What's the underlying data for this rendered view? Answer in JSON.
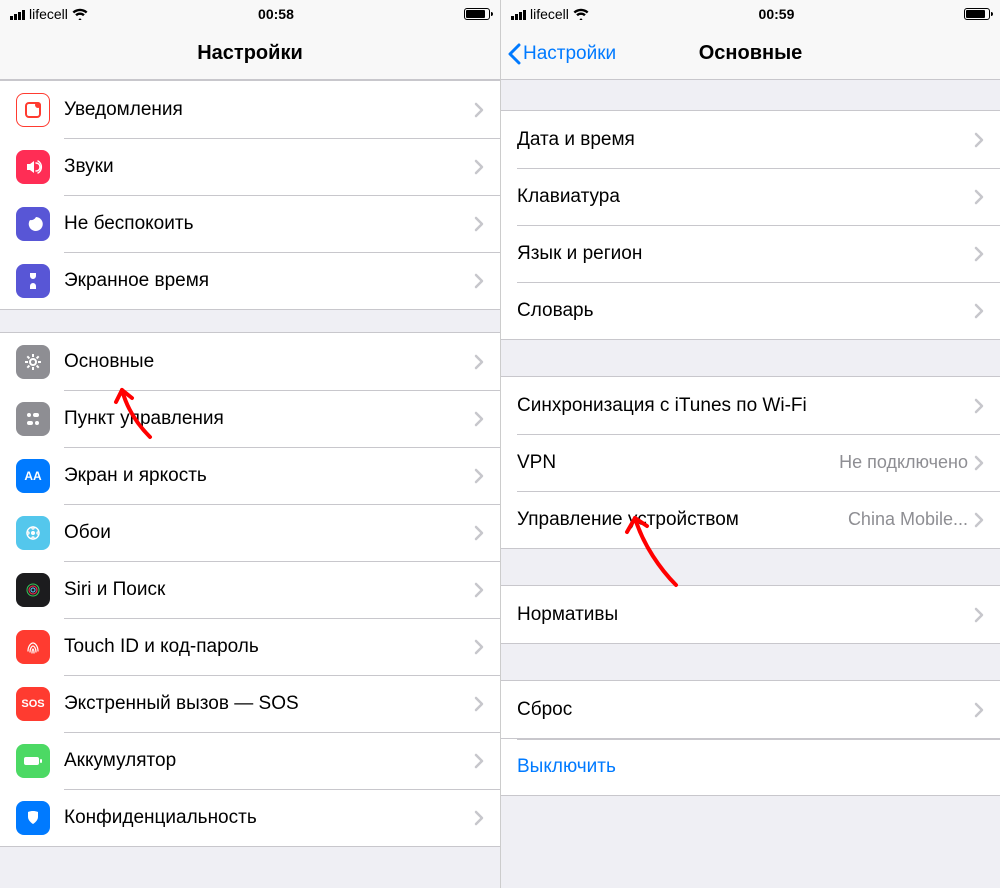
{
  "left": {
    "status": {
      "carrier": "lifecell",
      "time": "00:58"
    },
    "nav": {
      "title": "Настройки"
    },
    "group1": [
      {
        "id": "notifications",
        "label": "Уведомления",
        "iconBg": "#ffffff",
        "iconBorder": "#ff3b30"
      },
      {
        "id": "sounds",
        "label": "Звуки",
        "iconBg": "#ff2d55"
      },
      {
        "id": "dnd",
        "label": "Не беспокоить",
        "iconBg": "#5856d6"
      },
      {
        "id": "screentime",
        "label": "Экранное время",
        "iconBg": "#5856d6"
      }
    ],
    "group2": [
      {
        "id": "general",
        "label": "Основные",
        "iconBg": "#8e8e93"
      },
      {
        "id": "controlcenter",
        "label": "Пункт управления",
        "iconBg": "#8e8e93"
      },
      {
        "id": "display",
        "label": "Экран и яркость",
        "iconBg": "#007aff"
      },
      {
        "id": "wallpaper",
        "label": "Обои",
        "iconBg": "#54c7ec"
      },
      {
        "id": "siri",
        "label": "Siri и Поиск",
        "iconBg": "#000000"
      },
      {
        "id": "touchid",
        "label": "Touch ID и код-пароль",
        "iconBg": "#ff3b30"
      },
      {
        "id": "sos",
        "label": "Экстренный вызов — SOS",
        "iconBg": "#ff3b30"
      },
      {
        "id": "battery",
        "label": "Аккумулятор",
        "iconBg": "#4cd964"
      },
      {
        "id": "privacy",
        "label": "Конфиденциальность",
        "iconBg": "#007aff"
      }
    ]
  },
  "right": {
    "status": {
      "carrier": "lifecell",
      "time": "00:59"
    },
    "nav": {
      "back": "Настройки",
      "title": "Основные"
    },
    "group1": [
      {
        "id": "datetime",
        "label": "Дата и время"
      },
      {
        "id": "keyboard",
        "label": "Клавиатура"
      },
      {
        "id": "language",
        "label": "Язык и регион"
      },
      {
        "id": "dictionary",
        "label": "Словарь"
      }
    ],
    "group2": [
      {
        "id": "itunes-wifi",
        "label": "Синхронизация с iTunes по Wi-Fi"
      },
      {
        "id": "vpn",
        "label": "VPN",
        "value": "Не подключено"
      },
      {
        "id": "device-mgmt",
        "label": "Управление устройством",
        "value": "China Mobile..."
      }
    ],
    "group3": [
      {
        "id": "regulatory",
        "label": "Нормативы"
      }
    ],
    "group4": [
      {
        "id": "reset",
        "label": "Сброс"
      }
    ],
    "shutdown": "Выключить"
  }
}
